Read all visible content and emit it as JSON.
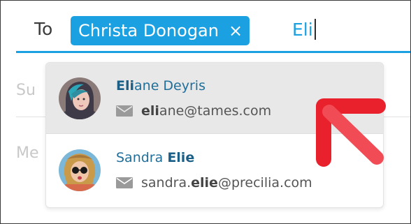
{
  "compose": {
    "to_label": "To",
    "recipient_chip": {
      "name": "Christa Donogan",
      "remove_glyph": "×"
    },
    "typed_text": "Eli",
    "subject_partial": "Su",
    "message_partial": "Me"
  },
  "suggestions": [
    {
      "name_match": "Eli",
      "name_rest": "ane Deyris",
      "email_match": "eli",
      "email_rest": "ane@tames.com",
      "highlighted": true
    },
    {
      "name_prefix": "Sandra ",
      "name_match": "Elie",
      "email_prefix": "sandra.",
      "email_match": "elie",
      "email_rest": "@precilia.com",
      "highlighted": false
    }
  ],
  "colors": {
    "accent": "#1ba1e1",
    "arrow": "#e8212c",
    "highlight_row": "#e8e8e8"
  },
  "icons": [
    "close-icon",
    "mail-icon",
    "avatar",
    "red-arrow-annotation"
  ]
}
